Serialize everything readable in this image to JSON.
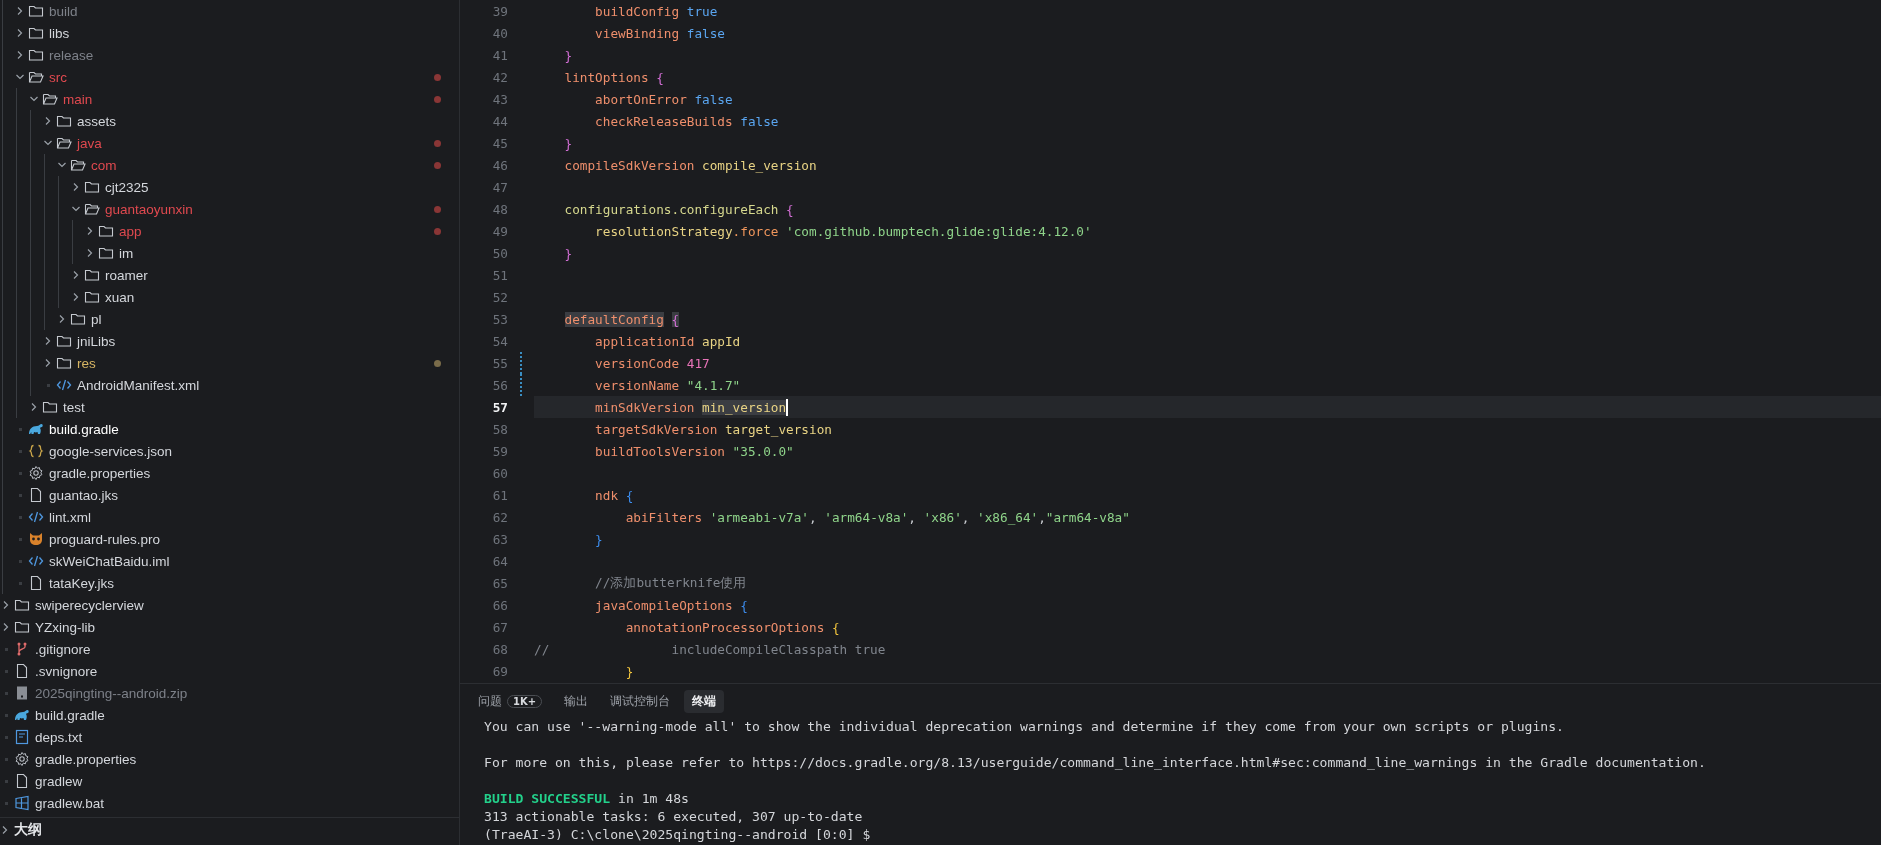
{
  "explorer": {
    "open_folder_contents": [
      {
        "label": "build",
        "kind": "folder",
        "expanded": false,
        "modified": false,
        "untracked": false,
        "dimmed": true,
        "selected": false
      },
      {
        "label": "libs",
        "kind": "folder",
        "expanded": false,
        "modified": false,
        "untracked": false,
        "dimmed": false,
        "selected": false
      },
      {
        "label": "release",
        "kind": "folder",
        "expanded": false,
        "modified": false,
        "untracked": false,
        "dimmed": true,
        "selected": false
      },
      {
        "label": "src",
        "kind": "folder",
        "expanded": true,
        "modified": true,
        "untracked": false,
        "dimmed": false,
        "selected": false,
        "children": [
          {
            "label": "main",
            "kind": "folder",
            "expanded": true,
            "modified": true,
            "untracked": false,
            "dimmed": false,
            "selected": false,
            "children": [
              {
                "label": "assets",
                "kind": "folder",
                "expanded": false,
                "modified": false,
                "untracked": false,
                "dimmed": false,
                "selected": false
              },
              {
                "label": "java",
                "kind": "folder",
                "expanded": true,
                "modified": true,
                "untracked": false,
                "dimmed": false,
                "selected": false,
                "children": [
                  {
                    "label": "com",
                    "kind": "folder",
                    "expanded": true,
                    "modified": true,
                    "untracked": false,
                    "dimmed": false,
                    "selected": false,
                    "children": [
                      {
                        "label": "cjt2325",
                        "kind": "folder",
                        "expanded": false,
                        "modified": false,
                        "untracked": false,
                        "dimmed": false,
                        "selected": false
                      },
                      {
                        "label": "guantaoyunxin",
                        "kind": "folder",
                        "expanded": true,
                        "modified": true,
                        "untracked": false,
                        "dimmed": false,
                        "selected": false,
                        "children": [
                          {
                            "label": "app",
                            "kind": "folder",
                            "expanded": false,
                            "modified": true,
                            "untracked": false,
                            "dimmed": false,
                            "selected": false
                          },
                          {
                            "label": "im",
                            "kind": "folder",
                            "expanded": false,
                            "modified": false,
                            "untracked": false,
                            "dimmed": false,
                            "selected": false
                          }
                        ]
                      },
                      {
                        "label": "roamer",
                        "kind": "folder",
                        "expanded": false,
                        "modified": false,
                        "untracked": false,
                        "dimmed": false,
                        "selected": false
                      },
                      {
                        "label": "xuan",
                        "kind": "folder",
                        "expanded": false,
                        "modified": false,
                        "untracked": false,
                        "dimmed": false,
                        "selected": false
                      }
                    ]
                  },
                  {
                    "label": "pl",
                    "kind": "folder",
                    "expanded": false,
                    "modified": false,
                    "untracked": false,
                    "dimmed": false,
                    "selected": false
                  }
                ]
              },
              {
                "label": "jniLibs",
                "kind": "folder",
                "expanded": false,
                "modified": false,
                "untracked": false,
                "dimmed": false,
                "selected": false
              },
              {
                "label": "res",
                "kind": "folder",
                "expanded": false,
                "modified": false,
                "untracked": true,
                "dimmed": false,
                "selected": false
              },
              {
                "label": "AndroidManifest.xml",
                "kind": "xml",
                "modified": false,
                "untracked": false,
                "dimmed": false,
                "selected": false
              }
            ]
          },
          {
            "label": "test",
            "kind": "folder",
            "expanded": false,
            "modified": false,
            "untracked": false,
            "dimmed": false,
            "selected": false
          }
        ]
      },
      {
        "label": "build.gradle",
        "kind": "gradle",
        "modified": false,
        "untracked": false,
        "dimmed": false,
        "selected": true
      },
      {
        "label": "google-services.json",
        "kind": "json",
        "modified": false,
        "untracked": false,
        "dimmed": false,
        "selected": false
      },
      {
        "label": "gradle.properties",
        "kind": "settings",
        "modified": false,
        "untracked": false,
        "dimmed": false,
        "selected": false
      },
      {
        "label": "guantao.jks",
        "kind": "file",
        "modified": false,
        "untracked": false,
        "dimmed": false,
        "selected": false
      },
      {
        "label": "lint.xml",
        "kind": "xml",
        "modified": false,
        "untracked": false,
        "dimmed": false,
        "selected": false
      },
      {
        "label": "proguard-rules.pro",
        "kind": "proguard",
        "modified": false,
        "untracked": false,
        "dimmed": false,
        "selected": false
      },
      {
        "label": "skWeiChatBaidu.iml",
        "kind": "xml",
        "modified": false,
        "untracked": false,
        "dimmed": false,
        "selected": false
      },
      {
        "label": "tataKey.jks",
        "kind": "file",
        "modified": false,
        "untracked": false,
        "dimmed": false,
        "selected": false
      }
    ],
    "items": [
      {
        "label": "swiperecyclerview",
        "kind": "folder",
        "expanded": false,
        "modified": false,
        "untracked": false,
        "dimmed": false,
        "selected": false
      },
      {
        "label": "YZxing-lib",
        "kind": "folder",
        "expanded": false,
        "modified": false,
        "untracked": false,
        "dimmed": false,
        "selected": false
      },
      {
        "label": ".gitignore",
        "kind": "git",
        "modified": false,
        "untracked": false,
        "dimmed": false,
        "selected": false
      },
      {
        "label": ".svnignore",
        "kind": "file",
        "modified": false,
        "untracked": false,
        "dimmed": false,
        "selected": false
      },
      {
        "label": "2025qingting--android.zip",
        "kind": "archive",
        "modified": false,
        "untracked": false,
        "dimmed": true,
        "selected": false
      },
      {
        "label": "build.gradle",
        "kind": "gradle",
        "modified": false,
        "untracked": false,
        "dimmed": false,
        "selected": false
      },
      {
        "label": "deps.txt",
        "kind": "text",
        "modified": false,
        "untracked": false,
        "dimmed": false,
        "selected": false
      },
      {
        "label": "gradle.properties",
        "kind": "settings",
        "modified": false,
        "untracked": false,
        "dimmed": false,
        "selected": false
      },
      {
        "label": "gradlew",
        "kind": "file",
        "modified": false,
        "untracked": false,
        "dimmed": false,
        "selected": false
      },
      {
        "label": "gradlew.bat",
        "kind": "windows",
        "modified": false,
        "untracked": false,
        "dimmed": false,
        "selected": false
      }
    ],
    "outline": {
      "label": "大纲",
      "expanded": false
    }
  },
  "editor": {
    "lines": [
      {
        "number": "39",
        "selected": false,
        "changed": false,
        "tokens": [
          {
            "text": "        buildConfig",
            "kind": "prop"
          },
          {
            "text": " true",
            "kind": "bool"
          }
        ]
      },
      {
        "number": "40",
        "selected": false,
        "changed": false,
        "tokens": [
          {
            "text": "        viewBinding",
            "kind": "prop"
          },
          {
            "text": " false",
            "kind": "bool"
          }
        ]
      },
      {
        "number": "41",
        "selected": false,
        "changed": false,
        "tokens": [
          {
            "text": "    }",
            "kind": "brace1"
          }
        ]
      },
      {
        "number": "42",
        "selected": false,
        "changed": false,
        "tokens": [
          {
            "text": "    lintOptions",
            "kind": "prop"
          },
          {
            "text": " {",
            "kind": "brace1"
          }
        ]
      },
      {
        "number": "43",
        "selected": false,
        "changed": false,
        "tokens": [
          {
            "text": "        abortOnError",
            "kind": "prop"
          },
          {
            "text": " false",
            "kind": "bool"
          }
        ]
      },
      {
        "number": "44",
        "selected": false,
        "changed": false,
        "tokens": [
          {
            "text": "        checkReleaseBuilds",
            "kind": "prop"
          },
          {
            "text": " false",
            "kind": "bool"
          }
        ]
      },
      {
        "number": "45",
        "selected": false,
        "changed": false,
        "tokens": [
          {
            "text": "    }",
            "kind": "brace1"
          }
        ]
      },
      {
        "number": "46",
        "selected": false,
        "changed": false,
        "tokens": [
          {
            "text": "    compileSdkVersion",
            "kind": "prop"
          },
          {
            "text": " compile_version",
            "kind": "ident"
          }
        ]
      },
      {
        "number": "47",
        "selected": false,
        "changed": false
      },
      {
        "number": "48",
        "selected": false,
        "changed": false,
        "tokens": [
          {
            "text": "    configurations.configureEach",
            "kind": "ident2"
          },
          {
            "text": " {",
            "kind": "brace1"
          }
        ]
      },
      {
        "number": "49",
        "selected": false,
        "changed": false,
        "tokens": [
          {
            "text": "        resolutionStrategy",
            "kind": "ident"
          },
          {
            "text": ".force",
            "kind": "method"
          },
          {
            "text": " 'com.github.bumptech.glide:glide:4.12.0'",
            "kind": "str"
          }
        ]
      },
      {
        "number": "50",
        "selected": false,
        "changed": false,
        "tokens": [
          {
            "text": "    }",
            "kind": "brace1"
          }
        ]
      },
      {
        "number": "51",
        "selected": false,
        "changed": false
      },
      {
        "number": "52",
        "selected": false,
        "changed": false
      },
      {
        "number": "53",
        "selected": false,
        "changed": false,
        "tokens": [
          {
            "text": "    defaultConfig",
            "kind": "prop_hl"
          },
          {
            "text": " {",
            "kind": "brace1_hl"
          }
        ]
      },
      {
        "number": "54",
        "selected": false,
        "changed": false,
        "tokens": [
          {
            "text": "        applicationId",
            "kind": "prop"
          },
          {
            "text": " appId",
            "kind": "ident"
          }
        ]
      },
      {
        "number": "55",
        "selected": false,
        "changed": true,
        "tokens": [
          {
            "text": "        versionCode",
            "kind": "prop"
          },
          {
            "text": " 417",
            "kind": "num"
          }
        ]
      },
      {
        "number": "56",
        "selected": false,
        "changed": true,
        "tokens": [
          {
            "text": "        versionName",
            "kind": "prop"
          },
          {
            "text": " \"4.1.7\"",
            "kind": "str"
          }
        ]
      },
      {
        "number": "57",
        "selected": true,
        "changed": false,
        "tokens": [
          {
            "text": "        minSdkVersion",
            "kind": "prop"
          },
          {
            "text": " min_version",
            "kind": "ident_hl"
          }
        ]
      },
      {
        "number": "58",
        "selected": false,
        "changed": false,
        "tokens": [
          {
            "text": "        targetSdkVersion",
            "kind": "prop"
          },
          {
            "text": " target_version",
            "kind": "ident"
          }
        ]
      },
      {
        "number": "59",
        "selected": false,
        "changed": false,
        "tokens": [
          {
            "text": "        buildToolsVersion",
            "kind": "prop"
          },
          {
            "text": " \"35.0.0\"",
            "kind": "str"
          }
        ]
      },
      {
        "number": "60",
        "selected": false,
        "changed": false
      },
      {
        "number": "61",
        "selected": false,
        "changed": false,
        "tokens": [
          {
            "text": "        ndk",
            "kind": "prop"
          },
          {
            "text": " {",
            "kind": "brace2"
          }
        ]
      },
      {
        "number": "62",
        "selected": false,
        "changed": false,
        "tokens": [
          {
            "text": "            abiFilters",
            "kind": "prop"
          },
          {
            "text": " 'armeabi-v7a'",
            "kind": "str"
          },
          {
            "text": ",",
            "kind": "plain"
          },
          {
            "text": " 'arm64-v8a'",
            "kind": "str"
          },
          {
            "text": ",",
            "kind": "plain"
          },
          {
            "text": " 'x86'",
            "kind": "str"
          },
          {
            "text": ",",
            "kind": "plain"
          },
          {
            "text": " 'x86_64'",
            "kind": "str"
          },
          {
            "text": ",",
            "kind": "plain"
          },
          {
            "text": "\"arm64-v8a\"",
            "kind": "str"
          }
        ]
      },
      {
        "number": "63",
        "selected": false,
        "changed": false,
        "tokens": [
          {
            "text": "        }",
            "kind": "brace2"
          }
        ]
      },
      {
        "number": "64",
        "selected": false,
        "changed": false
      },
      {
        "number": "65",
        "selected": false,
        "changed": false,
        "tokens": [
          {
            "text": "        //添加butterknife使用",
            "kind": "comment"
          }
        ]
      },
      {
        "number": "66",
        "selected": false,
        "changed": false,
        "tokens": [
          {
            "text": "        javaCompileOptions",
            "kind": "prop"
          },
          {
            "text": " {",
            "kind": "brace2"
          }
        ]
      },
      {
        "number": "67",
        "selected": false,
        "changed": false,
        "tokens": [
          {
            "text": "            annotationProcessorOptions",
            "kind": "prop"
          },
          {
            "text": " {",
            "kind": "brace3"
          }
        ]
      },
      {
        "number": "68",
        "selected": false,
        "changed": false,
        "tokens": [
          {
            "text": "//                includeCompileClasspath true",
            "kind": "comment"
          }
        ]
      },
      {
        "number": "69",
        "selected": false,
        "changed": false,
        "tokens": [
          {
            "text": "            }",
            "kind": "brace3"
          }
        ]
      }
    ]
  },
  "panel": {
    "tabs": [
      {
        "label": "问题",
        "badge": "1K+",
        "selected": false
      },
      {
        "label": "输出",
        "selected": false
      },
      {
        "label": "调试控制台",
        "selected": false
      },
      {
        "label": "终端",
        "selected": true
      }
    ],
    "terminal_lines": [
      {
        "kind": "text",
        "segments": [
          {
            "text": "You can use '--warning-mode all' to show the individual deprecation warnings and determine if they come from your own scripts or plugins.",
            "kind": "plain"
          }
        ]
      },
      {
        "kind": "blank"
      },
      {
        "kind": "text",
        "segments": [
          {
            "text": "For more on this, please refer to https://docs.gradle.org/8.13/userguide/command_line_interface.html#sec:command_line_warnings in the Gradle documentation.",
            "kind": "plain"
          }
        ]
      },
      {
        "kind": "blank"
      },
      {
        "kind": "text",
        "segments": [
          {
            "text": "BUILD SUCCESSFUL",
            "kind": "success"
          },
          {
            "text": " in 1m 48s",
            "kind": "plain"
          }
        ]
      },
      {
        "kind": "text",
        "segments": [
          {
            "text": "313 actionable tasks: 6 executed, 307 up-to-date",
            "kind": "plain"
          }
        ]
      },
      {
        "kind": "text",
        "segments": [
          {
            "text": "(TraeAI-3) C:\\clone\\2025qingting--android [0:0] $",
            "kind": "plain"
          }
        ]
      }
    ]
  }
}
